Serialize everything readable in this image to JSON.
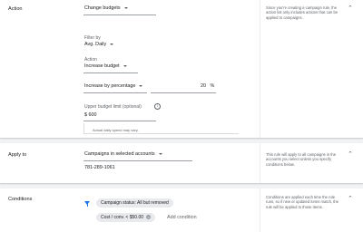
{
  "action_card": {
    "label": "Action",
    "type_dropdown": "Change budgets",
    "filter_label": "Filter by",
    "filter_value": "Avg. Daily",
    "action_label": "Action",
    "action_value": "Increase budget",
    "method_value": "Increase by percentage",
    "percent_value": "20",
    "percent_unit": "%",
    "limit_label": "Upper budget limit (optional)",
    "limit_value": "$ 600",
    "note": "Actual daily spend may vary.",
    "help": "Since you're creating a campaign rule, the action list only includes actions that can be applied to campaigns."
  },
  "apply_card": {
    "label": "Apply to",
    "scope_value": "Campaigns in selected accounts",
    "account": "781-289-1061",
    "help": "This rule will apply to all campaigns in the accounts you select unless you specify conditions below."
  },
  "conditions_card": {
    "label": "Conditions",
    "chips": [
      {
        "label": "Campaign status: All but removed"
      },
      {
        "label": "Cost / conv. < $50.00"
      }
    ],
    "add_label": "Add condition",
    "help": "Conditions are applied each time the rule runs, so if new or updated items match, the rule will be applied to those items."
  },
  "icons": {
    "collapse": "chevron-up-icon",
    "info": "info-icon",
    "filter": "filter-icon",
    "remove": "close-icon"
  },
  "colors": {
    "accent": "#1a73e8",
    "chip_bg": "#e8eaed"
  }
}
